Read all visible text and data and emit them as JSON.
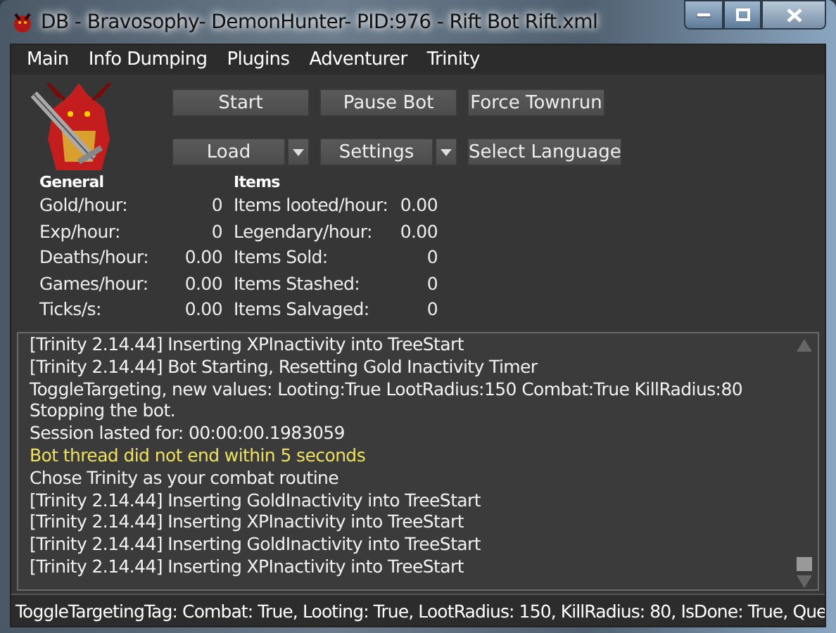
{
  "window": {
    "title": "DB - Bravosophy- DemonHunter- PID:976 - Rift Bot Rift.xml"
  },
  "menu": [
    "Main",
    "Info Dumping",
    "Plugins",
    "Adventurer",
    "Trinity"
  ],
  "buttons": [
    {
      "label": "Start",
      "kind": "plain"
    },
    {
      "label": "Pause Bot",
      "kind": "plain"
    },
    {
      "label": "Force Townrun",
      "kind": "plain"
    },
    {
      "label": "Load",
      "kind": "split"
    },
    {
      "label": "Settings",
      "kind": "split"
    },
    {
      "label": "Select Language",
      "kind": "plain"
    }
  ],
  "stats": [
    {
      "heading": "General",
      "rows": [
        {
          "label": "Gold/hour:",
          "value": "0"
        },
        {
          "label": "Exp/hour:",
          "value": "0"
        },
        {
          "label": "Deaths/hour:",
          "value": "0.00"
        },
        {
          "label": "Games/hour:",
          "value": "0.00"
        },
        {
          "label": "Ticks/s:",
          "value": "0.00"
        }
      ]
    },
    {
      "heading": "Items",
      "rows": [
        {
          "label": "Items looted/hour:",
          "value": "0.00"
        },
        {
          "label": "Legendary/hour:",
          "value": "0.00"
        },
        {
          "label": "Items Sold:",
          "value": "0"
        },
        {
          "label": "Items Stashed:",
          "value": "0"
        },
        {
          "label": "Items Salvaged:",
          "value": "0"
        }
      ]
    }
  ],
  "log": [
    {
      "text": "[Trinity 2.14.44] Inserting XPInactivity into TreeStart",
      "kind": "info"
    },
    {
      "text": "[Trinity 2.14.44] Bot Starting, Resetting Gold Inactivity Timer",
      "kind": "info"
    },
    {
      "text": "ToggleTargeting, new values: Looting:True LootRadius:150 Combat:True KillRadius:80",
      "kind": "info"
    },
    {
      "text": "Stopping the bot.",
      "kind": "info"
    },
    {
      "text": "Session lasted for: 00:00:00.1983059",
      "kind": "info"
    },
    {
      "text": "Bot thread did not end within 5 seconds",
      "kind": "warning"
    },
    {
      "text": "Chose Trinity as your combat routine",
      "kind": "info"
    },
    {
      "text": "[Trinity 2.14.44] Inserting GoldInactivity into TreeStart",
      "kind": "info"
    },
    {
      "text": "[Trinity 2.14.44] Inserting XPInactivity into TreeStart",
      "kind": "info"
    },
    {
      "text": "[Trinity 2.14.44] Inserting GoldInactivity into TreeStart",
      "kind": "info"
    },
    {
      "text": "[Trinity 2.14.44] Inserting XPInactivity into TreeStart",
      "kind": "info"
    }
  ],
  "status_bar": "ToggleTargetingTag: Combat: True, Looting: True, LootRadius: 150, KillRadius: 80, IsDone: True, Que"
}
